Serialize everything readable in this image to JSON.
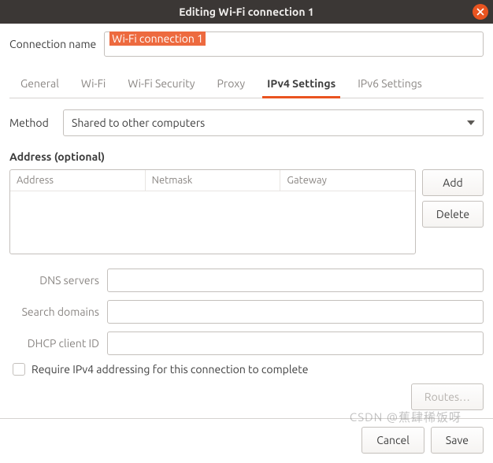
{
  "window": {
    "title": "Editing Wi-Fi connection 1"
  },
  "connection": {
    "label": "Connection name",
    "value": "Wi-Fi connection 1"
  },
  "tabs": {
    "list": [
      {
        "label": "General"
      },
      {
        "label": "Wi-Fi"
      },
      {
        "label": "Wi-Fi Security"
      },
      {
        "label": "Proxy"
      },
      {
        "label": "IPv4 Settings"
      },
      {
        "label": "IPv6 Settings"
      }
    ]
  },
  "method": {
    "label": "Method",
    "selected": "Shared to other computers"
  },
  "address": {
    "heading": "Address (optional)",
    "columns": {
      "address": "Address",
      "netmask": "Netmask",
      "gateway": "Gateway"
    },
    "buttons": {
      "add": "Add",
      "delete": "Delete"
    }
  },
  "fields": {
    "dns": {
      "label": "DNS servers",
      "value": ""
    },
    "search": {
      "label": "Search domains",
      "value": ""
    },
    "dhcp": {
      "label": "DHCP client ID",
      "value": ""
    }
  },
  "require": {
    "label": "Require IPv4 addressing for this connection to complete",
    "checked": false
  },
  "routes": {
    "label": "Routes…"
  },
  "footer": {
    "cancel": "Cancel",
    "save": "Save"
  },
  "watermark": "CSDN @蕉肆稀饭呀"
}
